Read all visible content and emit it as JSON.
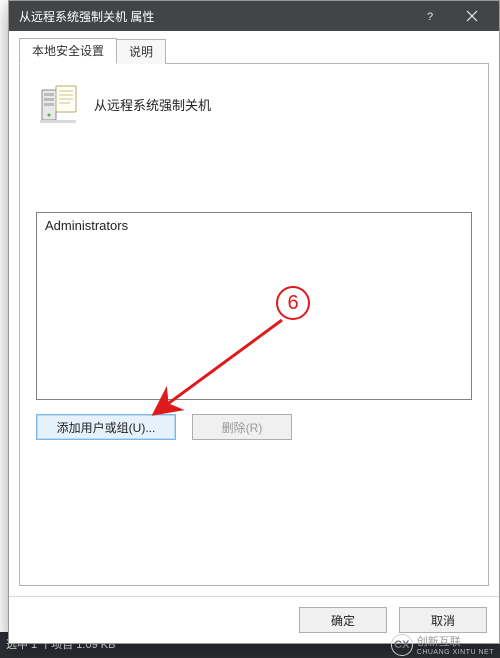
{
  "background": {
    "status_bar": "选中 1 个项目  1.09 KB"
  },
  "dialog": {
    "title": "从远程系统强制关机 属性",
    "tabs": [
      {
        "label": "本地安全设置",
        "active": true
      },
      {
        "label": "说明",
        "active": false
      }
    ],
    "policy_title": "从远程系统强制关机",
    "members": [
      "Administrators"
    ],
    "buttons": {
      "add_user_group": "添加用户或组(U)...",
      "remove": "删除(R)",
      "ok": "确定",
      "cancel": "取消"
    }
  },
  "annotation": {
    "step_number": "6",
    "color": "#dd1b1b"
  },
  "watermark": {
    "mark": "CX",
    "text": "创新互联",
    "sub": "CHUANG XINTU NET"
  }
}
